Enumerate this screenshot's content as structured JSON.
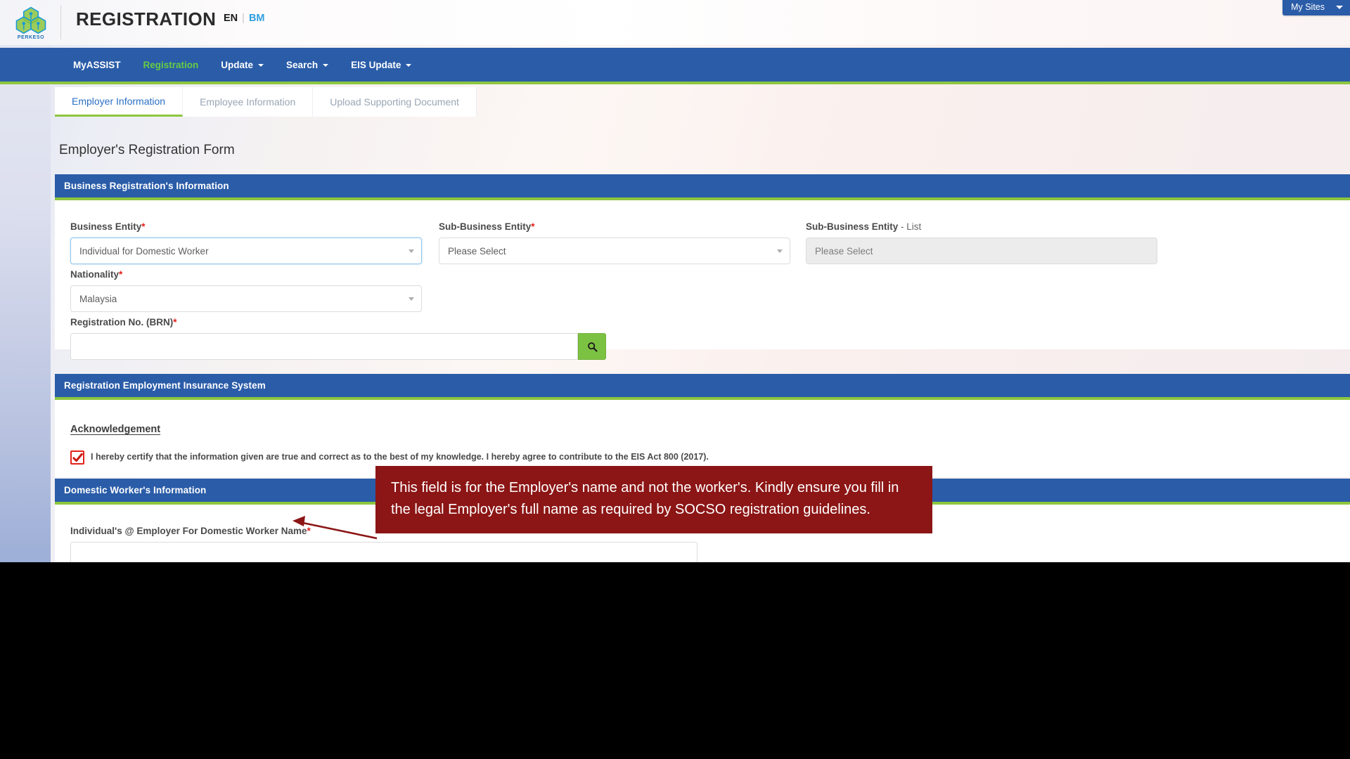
{
  "header": {
    "logo_alt": "PERKESO",
    "logo_caption": "PERKESO",
    "app_title": "REGISTRATION",
    "lang_en": "EN",
    "lang_sep": "|",
    "lang_bm": "BM",
    "my_sites_label": "My Sites"
  },
  "nav": {
    "items": [
      {
        "label": "MyASSIST",
        "active": false,
        "has_caret": false
      },
      {
        "label": "Registration",
        "active": true,
        "has_caret": false
      },
      {
        "label": "Update",
        "active": false,
        "has_caret": true
      },
      {
        "label": "Search",
        "active": false,
        "has_caret": true
      },
      {
        "label": "EIS Update",
        "active": false,
        "has_caret": true
      }
    ]
  },
  "tabs": [
    {
      "label": "Employer Information",
      "active": true
    },
    {
      "label": "Employee Information",
      "active": false
    },
    {
      "label": "Upload Supporting Document",
      "active": false
    }
  ],
  "form": {
    "title": "Employer's Registration Form",
    "sections": {
      "business": {
        "heading": "Business Registration's Information",
        "business_entity": {
          "label": "Business Entity",
          "required_marker": "*",
          "value": "Individual for Domestic Worker"
        },
        "sub_business_entity": {
          "label": "Sub-Business Entity",
          "required_marker": "*",
          "value": "Please Select"
        },
        "sub_business_entity_list": {
          "label": "Sub-Business Entity",
          "label_suffix": " - List",
          "value": "Please Select"
        },
        "nationality": {
          "label": "Nationality",
          "required_marker": "*",
          "value": "Malaysia"
        },
        "brn": {
          "label": "Registration No. (BRN)",
          "required_marker": "*",
          "value": "",
          "placeholder": "",
          "search_icon": "search-icon"
        }
      },
      "eis": {
        "heading": "Registration Employment Insurance System",
        "acknowledgement_title": "Acknowledgement",
        "checkbox_checked": true,
        "checkbox_text": "I hereby certify that the information given are true and correct as to the best of my knowledge. I hereby agree to contribute to the EIS Act 800 (2017)."
      },
      "domestic": {
        "heading": "Domestic Worker's Information",
        "employer_name": {
          "label": "Individual's @ Employer For Domestic Worker Name",
          "required_marker": "*",
          "value": "",
          "placeholder": ""
        }
      }
    }
  },
  "annotation": {
    "text": "This field is for the Employer's name and not the worker's. Kindly ensure you fill in the legal Employer's full name as required by SOCSO registration guidelines.",
    "color": "#8c1515"
  },
  "theme": {
    "brand_blue": "#2a5ca8",
    "brand_green": "#8dc63f",
    "accent_green_text": "#66cc44",
    "link_blue": "#2f9fe0",
    "required_red": "#e41b17",
    "search_button_green": "#7cc242"
  }
}
